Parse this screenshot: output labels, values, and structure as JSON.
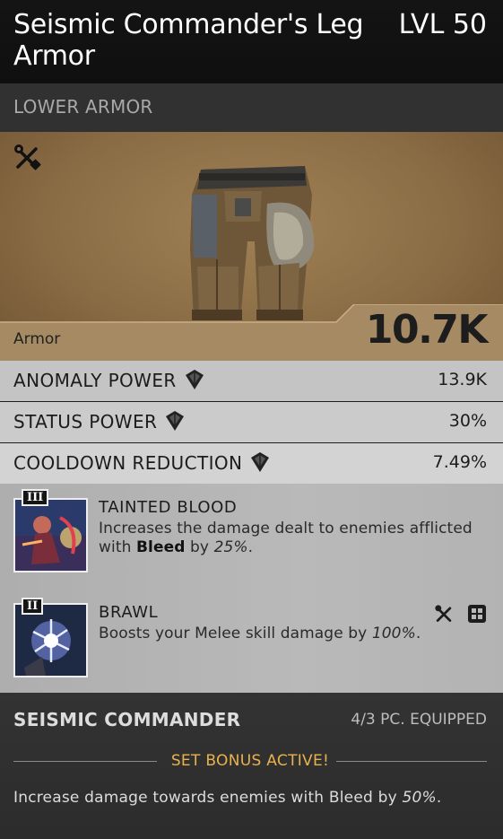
{
  "item": {
    "title": "Seismic Commander's Leg Armor",
    "level": "LVL 50",
    "category": "LOWER ARMOR",
    "armor_label": "Armor",
    "armor_value": "10.7K"
  },
  "stats": [
    {
      "name": "ANOMALY POWER",
      "value": "13.9K",
      "icon": "anomaly-gem-icon"
    },
    {
      "name": "STATUS POWER",
      "value": "30%",
      "icon": "anomaly-gem-icon"
    },
    {
      "name": "COOLDOWN REDUCTION",
      "value": "7.49%",
      "icon": "anomaly-gem-icon"
    }
  ],
  "mods": [
    {
      "tier": "III",
      "name": "TAINTED BLOOD",
      "desc_pre": "Increases the damage dealt to enemies afflicted with ",
      "desc_bold": "Bleed",
      "desc_mid": " by ",
      "desc_em": "25%",
      "desc_post": "."
    },
    {
      "tier": "II",
      "name": "BRAWL",
      "desc_pre": "Boosts your Melee skill damage by ",
      "desc_em": "100%",
      "desc_post": ".",
      "type_icons": [
        "tools-icon",
        "grid-icon"
      ]
    }
  ],
  "set": {
    "name": "SEISMIC COMMANDER",
    "equipped": "4/3 PC. EQUIPPED",
    "active": "SET BONUS ACTIVE!",
    "desc_pre": "Increase damage towards enemies with Bleed by ",
    "desc_em": "50%",
    "desc_post": "."
  },
  "colors": {
    "accent": "#e9b24c",
    "panel_bronze": "#8b6d45"
  }
}
